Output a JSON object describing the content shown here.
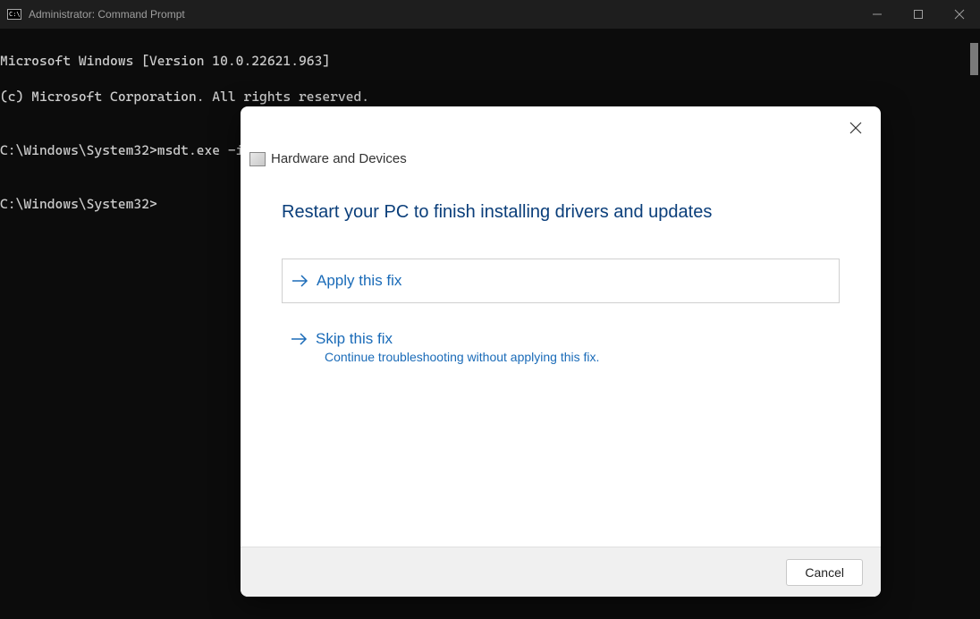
{
  "titlebar": {
    "title": "Administrator: Command Prompt"
  },
  "terminal": {
    "line1": "Microsoft Windows [Version 10.0.22621.963]",
    "line2": "(c) Microsoft Corporation. All rights reserved.",
    "line3": "",
    "line4": "C:\\Windows\\System32>msdt.exe -id DeviceDIagnostic",
    "line5": "",
    "line6": "C:\\Windows\\System32>"
  },
  "dialog": {
    "header_title": "Hardware and Devices",
    "main_title": "Restart your PC to finish installing drivers and updates",
    "apply_label": "Apply this fix",
    "skip_label": "Skip this fix",
    "skip_sub": "Continue troubleshooting without applying this fix.",
    "cancel_label": "Cancel"
  }
}
